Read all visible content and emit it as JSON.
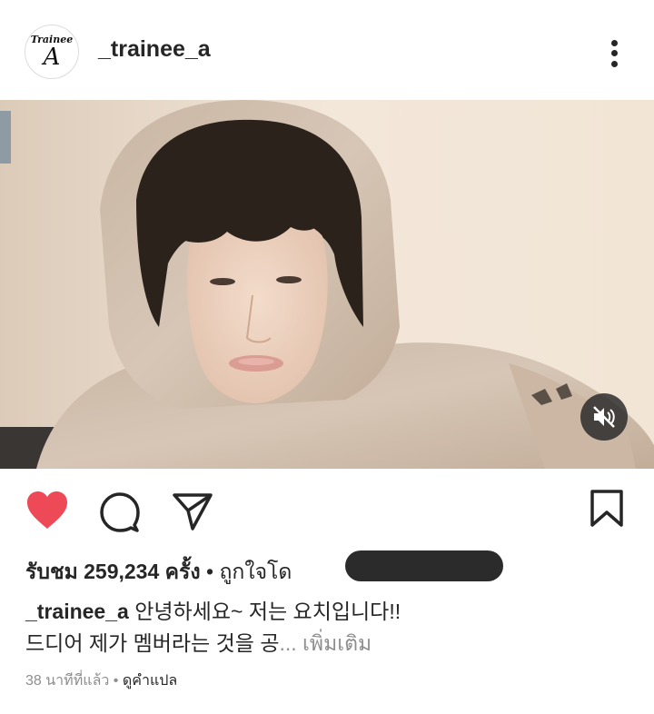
{
  "post": {
    "username": "_trainee_a",
    "avatar_logo_top": "Trainee",
    "avatar_logo_main": "A"
  },
  "stats": {
    "views_label": "รับชม",
    "views_count": "259,234",
    "views_unit": "ครั้ง",
    "separator": " • ",
    "liked_by_label": "ถูกใจโด"
  },
  "caption": {
    "username": "_trainee_a",
    "line1": " 안녕하세요~ 저는 요치입니다!!",
    "line2": "드디어 제가 멤버라는 것을 공",
    "ellipsis": "... ",
    "more_label": "เพิ่มเติม"
  },
  "meta": {
    "time_ago": "38 นาทีที่แล้ว",
    "separator": " • ",
    "translate_label": "ดูคำแปล"
  },
  "colors": {
    "like_red": "#ed4956",
    "text": "#262626",
    "secondary": "#8e8e8e"
  },
  "icons": [
    "more-vertical-icon",
    "mute-icon",
    "heart-icon",
    "comment-icon",
    "share-icon",
    "bookmark-icon"
  ]
}
